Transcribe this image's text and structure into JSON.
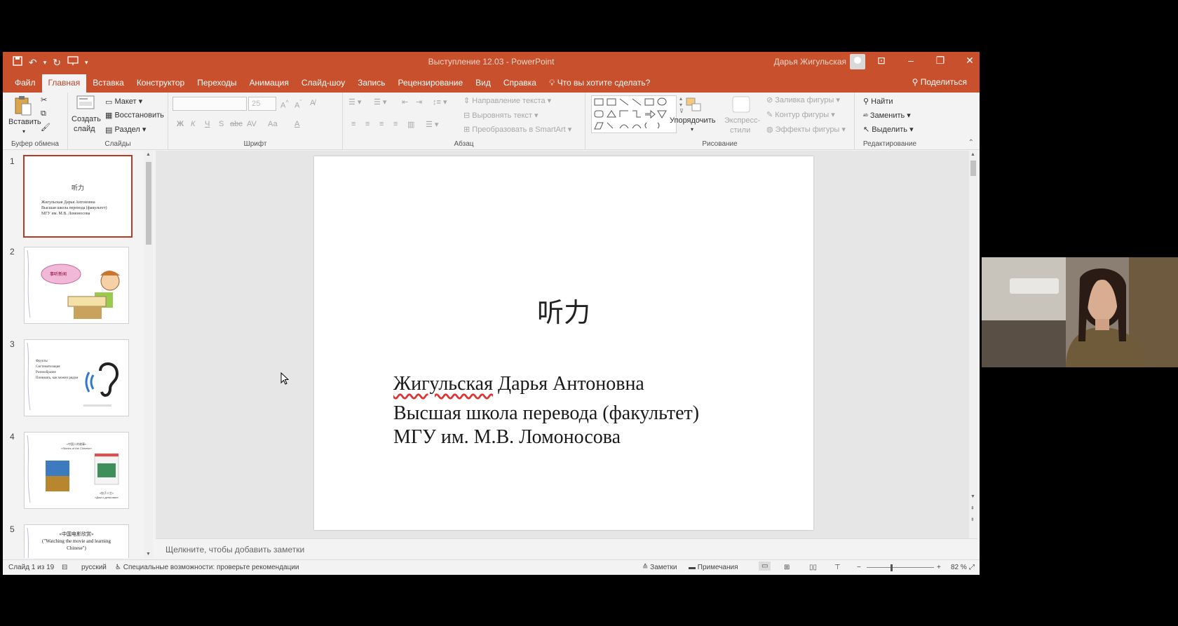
{
  "titlebar": {
    "doc_title": "Выступление 12.03  -  PowerPoint",
    "user_name": "Дарья Жигульская"
  },
  "tabs": [
    "Файл",
    "Главная",
    "Вставка",
    "Конструктор",
    "Переходы",
    "Анимация",
    "Слайд-шоу",
    "Запись",
    "Рецензирование",
    "Вид",
    "Справка"
  ],
  "tell_me": "Что вы хотите сделать?",
  "share": "Поделиться",
  "ribbon": {
    "clipboard": {
      "paste": "Вставить",
      "label": "Буфер обмена"
    },
    "slides": {
      "new_slide_1": "Создать",
      "new_slide_2": "слайд",
      "layout": "Макет",
      "reset": "Восстановить",
      "section": "Раздел",
      "label": "Слайды"
    },
    "font": {
      "size": "25",
      "label": "Шрифт",
      "bold": "Ж",
      "italic": "К",
      "underline": "Ч",
      "shadow": "S",
      "strike": "abc",
      "spacing": "AV",
      "case": "Аа",
      "color": "А"
    },
    "paragraph": {
      "text_direction": "Направление текста",
      "align_text": "Выровнять текст",
      "smartart": "Преобразовать в SmartArt",
      "label": "Абзац"
    },
    "drawing": {
      "arrange": "Упорядочить",
      "quick_styles_1": "Экспресс-",
      "quick_styles_2": "стили",
      "shape_fill": "Заливка фигуры",
      "shape_outline": "Контур фигуры",
      "shape_effects": "Эффекты фигуры",
      "label": "Рисование"
    },
    "editing": {
      "find": "Найти",
      "replace": "Заменить",
      "select": "Выделить",
      "label": "Редактирование"
    }
  },
  "thumbnails": [
    {
      "num": "1",
      "title": "听力",
      "lines": [
        "Жигульская Дарья Антоновна",
        "Высшая школа перевода (факультет)",
        "МГУ им. М.В. Ломоносова"
      ]
    },
    {
      "num": "2",
      "cloud": "事听新闻"
    },
    {
      "num": "3",
      "bullets": [
        "Фрукты",
        "Систематизация",
        "Разнообразие",
        "Понимать, как можно рядом"
      ]
    },
    {
      "num": "4",
      "header_1": "«中国人的故事»",
      "header_2": "«Stories of the Chinese»",
      "caption_1": "«饺子人生»",
      "caption_2": "«Дом с деньгами»"
    },
    {
      "num": "5",
      "title_1": "«中国电影欣赏»",
      "title_2": "(\"Watching the movie and learning",
      "title_3": "Chinese\")"
    }
  ],
  "slide": {
    "title": "听力",
    "name": "Жигульская Дарья Антоновна",
    "name_underlined": "Жигульская",
    "name_rest": " Дарья Антоновна",
    "line2": "Высшая школа перевода (факультет)",
    "line3": "МГУ им. М.В. Ломоносова"
  },
  "notes_placeholder": "Щелкните, чтобы добавить заметки",
  "statusbar": {
    "slide_counter": "Слайд 1 из 19",
    "language": "русский",
    "accessibility": "Специальные возможности: проверьте рекомендации",
    "notes": "Заметки",
    "comments": "Примечания",
    "zoom": "82 %"
  },
  "colors": {
    "accent": "#c8502c",
    "selected_thumb": "#b83a24"
  }
}
